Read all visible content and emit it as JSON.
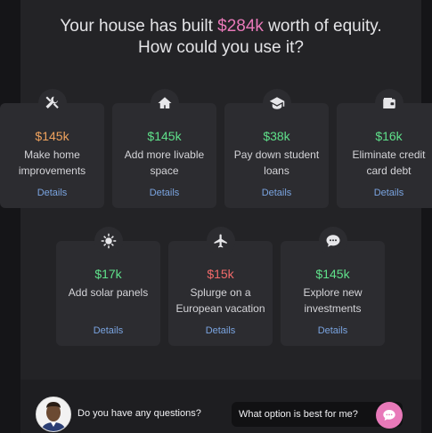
{
  "headline": {
    "line1_prefix": "Your house has built ",
    "equity_amount": "$284k",
    "line1_suffix": " worth of equity.",
    "line2": "How could you use it?"
  },
  "options": [
    {
      "amount": "$145k",
      "amount_color": "#f0a35e",
      "label": "Make home improvements",
      "details": "Details",
      "icon": "tools-icon"
    },
    {
      "amount": "$145k",
      "amount_color": "#5fe08a",
      "label": "Add more livable space",
      "details": "Details",
      "icon": "house-icon"
    },
    {
      "amount": "$38k",
      "amount_color": "#5fe08a",
      "label": "Pay down student loans",
      "details": "Details",
      "icon": "graduation-cap-icon"
    },
    {
      "amount": "$16k",
      "amount_color": "#5fe08a",
      "label": "Eliminate credit card debt",
      "details": "Details",
      "icon": "wallet-icon"
    },
    {
      "amount": "$17k",
      "amount_color": "#5fe08a",
      "label": "Add solar panels",
      "details": "Details",
      "icon": "sun-icon"
    },
    {
      "amount": "$15k",
      "amount_color": "#f26a6a",
      "label": "Splurge on a European vacation",
      "details": "Details",
      "icon": "airplane-icon"
    },
    {
      "amount": "$145k",
      "amount_color": "#5fe08a",
      "label": "Explore new investments",
      "details": "Details",
      "icon": "chat-bubble-icon"
    }
  ],
  "chat": {
    "prompt": "Do you have any questions?",
    "input_value": "What option is best for me?",
    "send_icon": "chat-send-icon"
  }
}
